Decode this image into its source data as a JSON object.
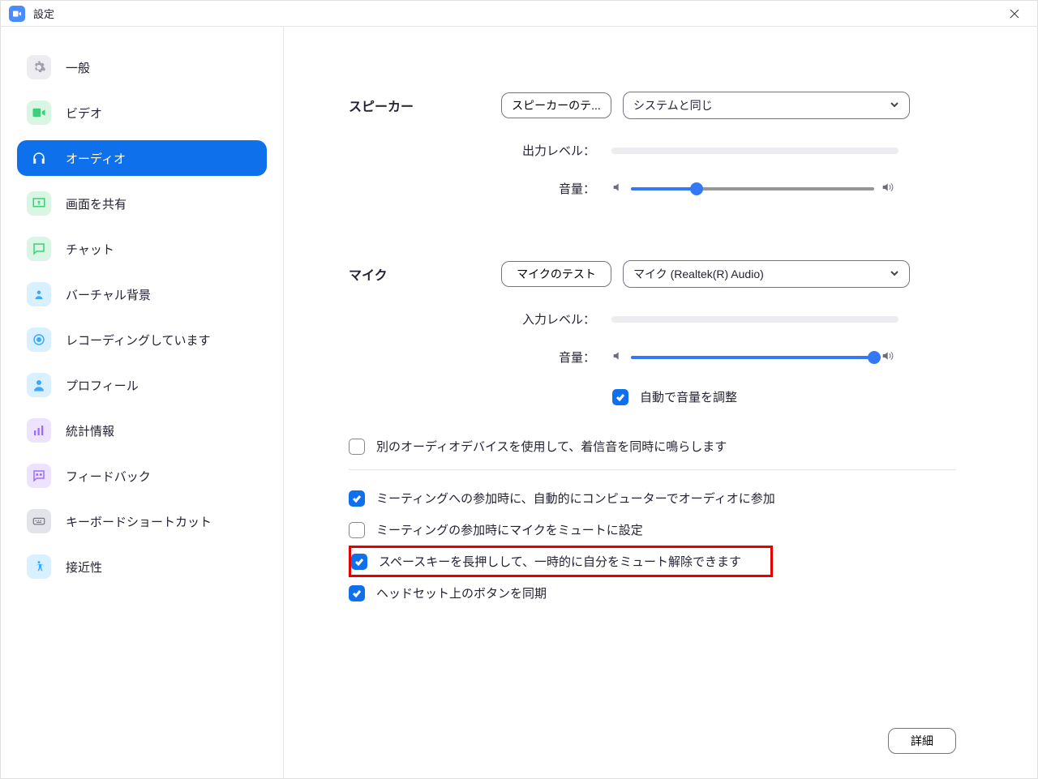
{
  "window": {
    "title": "設定"
  },
  "sidebar": {
    "items": [
      {
        "key": "general",
        "label": "一般"
      },
      {
        "key": "video",
        "label": "ビデオ"
      },
      {
        "key": "audio",
        "label": "オーディオ"
      },
      {
        "key": "share",
        "label": "画面を共有"
      },
      {
        "key": "chat",
        "label": "チャット"
      },
      {
        "key": "vbg",
        "label": "バーチャル背景"
      },
      {
        "key": "recording",
        "label": "レコーディングしています"
      },
      {
        "key": "profile",
        "label": "プロフィール"
      },
      {
        "key": "stats",
        "label": "統計情報"
      },
      {
        "key": "feedback",
        "label": "フィードバック"
      },
      {
        "key": "keyboard",
        "label": "キーボードショートカット"
      },
      {
        "key": "accessibility",
        "label": "接近性"
      }
    ]
  },
  "speaker": {
    "heading": "スピーカー",
    "test_btn": "スピーカーのテ...",
    "device": "システムと同じ",
    "output_level": "出力レベル：",
    "volume_label": "音量：",
    "volume_percent": 27
  },
  "mic": {
    "heading": "マイク",
    "test_btn": "マイクのテスト",
    "device": "マイク (Realtek(R) Audio)",
    "input_level": "入力レベル：",
    "volume_label": "音量：",
    "volume_percent": 100,
    "auto_adjust": "自動で音量を調整"
  },
  "options": {
    "ring_separate": "別のオーディオデバイスを使用して、着信音を同時に鳴らします",
    "auto_join": "ミーティングへの参加時に、自動的にコンピューターでオーディオに参加",
    "mute_on_join": "ミーティングの参加時にマイクをミュートに設定",
    "space_unmute": "スペースキーを長押しして、一時的に自分をミュート解除できます",
    "headset_sync": "ヘッドセット上のボタンを同期"
  },
  "advanced_btn": "詳細"
}
